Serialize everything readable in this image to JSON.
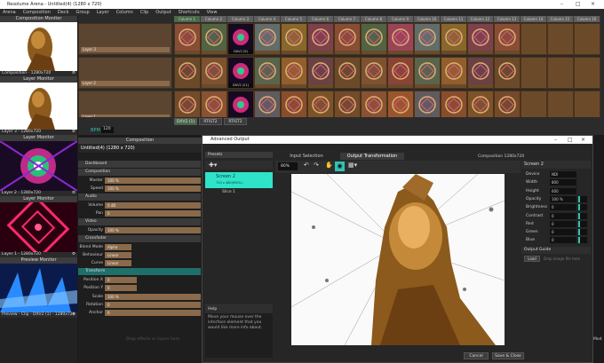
{
  "app": {
    "title": "Resolume Arena - Untitled(4) (1280 x 720)"
  },
  "menu": [
    "Arena",
    "Composition",
    "Deck",
    "Group",
    "Layer",
    "Column",
    "Clip",
    "Output",
    "Shortcuts",
    "View"
  ],
  "left": {
    "comp_monitor": "Composition Monitor",
    "comp_caption": "Composition - 1280x720",
    "layer_monitor": "Layer Monitor",
    "layer3_caption": "Layer 3 - 1280x720",
    "layer2_caption": "Layer 2 - 1280x720",
    "layer1_caption": "Layer 1 - 1280x720",
    "preview_monitor": "Preview Monitor",
    "preview_caption": "Preview - Clip - DXV2 (1) - 1280x720"
  },
  "columns": [
    "Column 1",
    "Column 2",
    "Column 3",
    "Column 4",
    "Column 5",
    "Column 6",
    "Column 7",
    "Column 8",
    "Column 9",
    "Column 10",
    "Column 11",
    "Column 12",
    "Column 13",
    "Column 14",
    "Column 15",
    "Column 16"
  ],
  "clip_labels": {
    "row1": "DXV2 (9)",
    "row2": "DXV2 (21)",
    "row3": "DXV2 (11)"
  },
  "decks": [
    "DXV2 (1)",
    "RTIST2",
    "RTIST2"
  ],
  "layer_names": [
    "Layer 3",
    "Layer 2",
    "Layer 1"
  ],
  "bpm": {
    "label": "BPM",
    "value": "120"
  },
  "composition": {
    "header": "Composition",
    "name": "Untitled(4) (1280 x 720)",
    "sections": {
      "dashboard": "Dashboard",
      "composition": "Composition",
      "audio": "Audio",
      "video": "Video",
      "crossfader": "Crossfader",
      "transform": "Transform"
    },
    "props": {
      "master": "Master",
      "master_v": "100 %",
      "speed": "Speed",
      "speed_v": "100 %",
      "volume": "Volume",
      "volume_v": "0 dB",
      "pan": "Pan",
      "pan_v": "0",
      "opacity": "Opacity",
      "opacity_v": "100 %",
      "blend": "Blend Mode",
      "blend_v": "Alpha",
      "behaviour": "Behaviour",
      "behaviour_v": "Linear",
      "curve": "Curve",
      "curve_v": "Linear",
      "posx": "Position X",
      "posx_v": "0",
      "posy": "Position Y",
      "posy_v": "0",
      "scale": "Scale",
      "scale_v": "100 %",
      "rotation": "Rotation",
      "rotation_v": "0",
      "anchor": "Anchor",
      "anchor_v": "0"
    },
    "drop_hint": "Drop effects or layers here"
  },
  "dialog": {
    "title": "Advanced Output",
    "presets_label": "Presets",
    "screen_name": "Screen 2",
    "screen_sub": "720 x 480(MVOL)",
    "slice": "Slice 1",
    "tabs": [
      "Input Selection",
      "Output Transformation"
    ],
    "comp_info": "Composition 1280x720",
    "zoom": "80%",
    "help_title": "Help",
    "help_text": "Move your mouse over the interface element that you would like more info about.",
    "right_title": "Screen 2",
    "props": [
      {
        "n": "Device",
        "v": "NDI"
      },
      {
        "n": "Width",
        "v": "800"
      },
      {
        "n": "Height",
        "v": "600"
      },
      {
        "n": "Opacity",
        "v": "100 %"
      },
      {
        "n": "Brightness",
        "v": "0"
      },
      {
        "n": "Contrast",
        "v": "0"
      },
      {
        "n": "Red",
        "v": "0"
      },
      {
        "n": "Green",
        "v": "0"
      },
      {
        "n": "Blue",
        "v": "0"
      }
    ],
    "output_guide": "Output Guide",
    "guide_btn": "Load",
    "guide_hint": "Drop image file here",
    "cancel": "Cancel",
    "save": "Save & Close"
  },
  "taskbar": {
    "hint": "Mod"
  }
}
